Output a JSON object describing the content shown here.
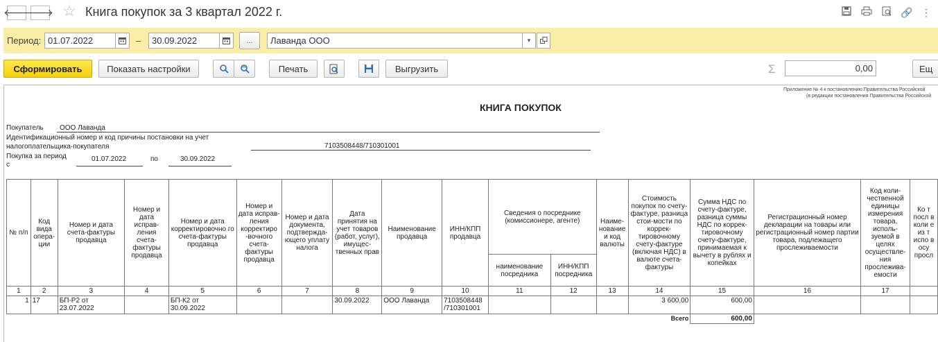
{
  "window": {
    "title": "Книга покупок за 3 квартал 2022 г.",
    "back_icon": "arrow-left-icon",
    "forward_icon": "arrow-right-icon",
    "more_label": "⋮"
  },
  "period": {
    "label": "Период:",
    "date_from": "01.07.2022",
    "dash": "–",
    "date_to": "30.09.2022",
    "choose_label": "...",
    "organization": "Лаванда ООО"
  },
  "toolbar": {
    "generate_label": "Сформировать",
    "settings_label": "Показать настройки",
    "print_label": "Печать",
    "export_label": "Выгрузить",
    "sum_value": "0,00",
    "more_label": "Ещ"
  },
  "report": {
    "appendix_line1": "Приложение № 4 к постановлению Правительства Российской",
    "appendix_line2": "(в редакции постановления Правительства Российской",
    "heading": "КНИГА ПОКУПОК",
    "buyer_label": "Покупатель",
    "buyer_value": "ООО Лаванда",
    "inn_label_line1": "Идентификационный номер и код причины постановки на учет",
    "inn_label_line2": "налогоплательщика-покупателя",
    "inn_value": "7103508448/710301001",
    "period_label_line1": "Покупка за период",
    "period_label_line2": "с",
    "period_from": "01.07.2022",
    "period_by": "по",
    "period_to": "30.09.2022",
    "columns": {
      "c1": "№ п/п",
      "c2": "Код вида опера-ции",
      "c3": "Номер и дата счета-фактуры продавца",
      "c4": "Номер и дата исправ-ления счета-фактуры продавца",
      "c5": "Номер и дата корректировочно го счета-фактуры продавца",
      "c6": "Номер и дата исправ-ления корректиро -вочного счета-фактуры продавца",
      "c7": "Номер и дата документа, подтвержда-ющего уплату налога",
      "c8": "Дата принятия на учет товаров (работ, услуг), имущес-твенных прав",
      "c9": "Наименование продавца",
      "c10": "ИНН/КПП продавца",
      "c11_12": "Сведения о посреднике (комиссионере, агенте)",
      "c11": "наименование посредника",
      "c12": "ИНН/КПП посредника",
      "c13": "Наиме-нование и код валюты",
      "c14": "Стоимость покупок по счету-фактуре, разница стои-мости по коррек-тировочному счету-фактуре (включая НДС) в валюте счета-фактуры",
      "c15": "Сумма НДС по счету-фактуре, разница суммы НДС по коррек-тировочному счету-фактуре, принимаемая к вычету в рублях и копейках",
      "c16": "Регистрационный номер декларации на товары или регистрационный номер партии товара, подлежащего прослеживаемости",
      "c17": "Код коли-чественной единицы измерения товара, исполь-зуемой в целях осуществле-ния прослежива-емости",
      "c18": "Ко т посл в коли е из т испо в осу просл"
    },
    "numbers": [
      "1",
      "2",
      "3",
      "4",
      "5",
      "6",
      "7",
      "8",
      "9",
      "10",
      "11",
      "12",
      "13",
      "14",
      "15",
      "16",
      "17"
    ],
    "row": {
      "n": "1",
      "op_code": "17",
      "invoice": "БП-Р2 от 23.07.2022",
      "corr_invoice": "БП-К2 от 30.09.2022",
      "accept_date": "30.09.2022",
      "seller": "ООО Лаванда",
      "seller_inn": "7103508448 /710301001",
      "cost": "3 600,00",
      "vat": "600,00"
    },
    "total_label": "Всего",
    "total_vat": "600,00"
  }
}
